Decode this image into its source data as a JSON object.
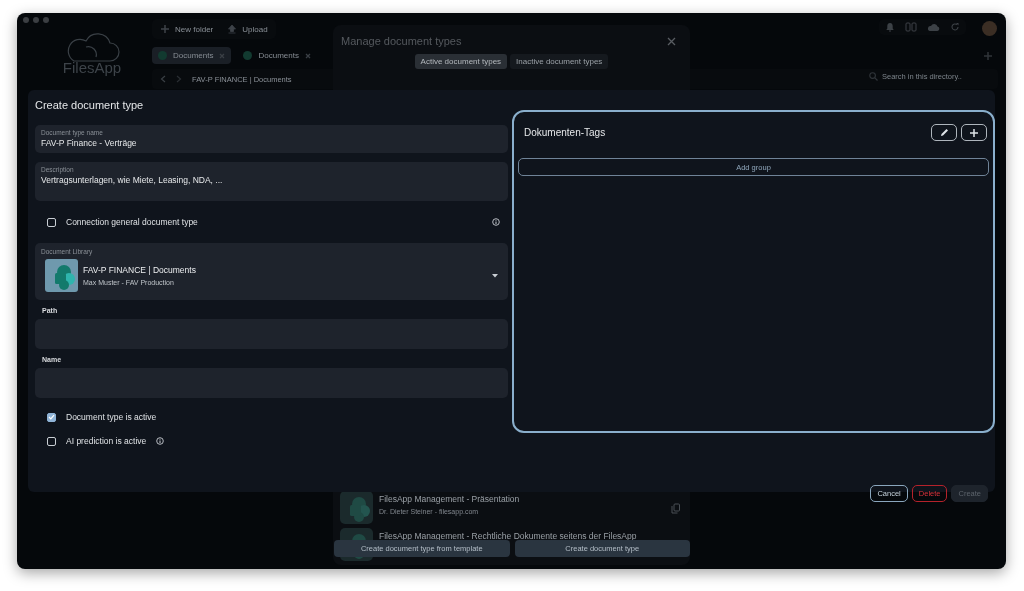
{
  "sidebar": {
    "logo_text": "FilesApp"
  },
  "toolbar": {
    "buttons": [
      {
        "label": "New folder",
        "kind": "plus"
      },
      {
        "label": "Upload",
        "kind": "upload"
      }
    ]
  },
  "tabs": [
    {
      "label": "Documents",
      "selected": true
    },
    {
      "label": "Documents",
      "selected": false
    }
  ],
  "breadcrumb": {
    "path": "FAV-P FINANCE | Documents"
  },
  "search": {
    "placeholder": "Search in this directory.."
  },
  "manage_dialog": {
    "title": "Manage document types",
    "tabs": [
      {
        "label": "Active document types",
        "selected": true
      },
      {
        "label": "Inactive document types",
        "selected": false
      }
    ],
    "items": [
      {
        "title": "FilesApp Management - Präsentation",
        "subtitle": "Dr. Dieter Steiner - filesapp.com"
      },
      {
        "title": "FilesApp Management - Rechtliche Dokumente seitens der FilesApp"
      }
    ],
    "buttons": [
      "Create document type from template",
      "Create document type"
    ]
  },
  "create_dialog": {
    "title": "Create document type",
    "name_field": {
      "label": "Document type name",
      "value": "FAV-P Finance - Verträge"
    },
    "description_field": {
      "label": "Description",
      "value": "Vertragsunterlagen, wie Miete, Leasing, NDA, ..."
    },
    "connection_checkbox": {
      "label": "Connection general document type",
      "checked": false,
      "info": true
    },
    "library": {
      "label": "Document Library",
      "title": "FAV-P FINANCE | Documents",
      "subtitle": "Max Muster - FAV Production"
    },
    "path_field": {
      "label": "Path"
    },
    "filename_field": {
      "label": "Name"
    },
    "checkboxes": [
      {
        "label": "Document type is active",
        "checked": true,
        "info": false
      },
      {
        "label": "AI prediction is active",
        "checked": false,
        "info": true
      }
    ],
    "tags_panel": {
      "title": "Dokumenten-Tags",
      "add_button": "Add group"
    },
    "buttons": [
      {
        "label": "Cancel",
        "kind": "outline"
      },
      {
        "label": "Delete",
        "kind": "danger"
      },
      {
        "label": "Create",
        "kind": "disabled"
      }
    ]
  }
}
